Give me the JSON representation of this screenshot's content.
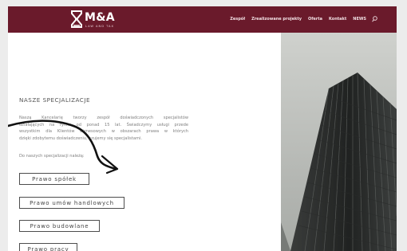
{
  "header": {
    "logo": {
      "name": "M&A",
      "subtitle": "LAW AND TAX",
      "mark_icon": "hourglass-logo"
    },
    "nav": [
      {
        "label": "Zespół"
      },
      {
        "label": "Zrealizowane projekty"
      },
      {
        "label": "Oferta"
      },
      {
        "label": "Kontakt"
      },
      {
        "label": "NEWS"
      }
    ],
    "search_icon": "search-icon"
  },
  "main": {
    "heading": "NASZE SPECJALIZACJE",
    "paragraph_lines": [
      "Naszą Kancelarię tworzy zespół doświadczonych specjalistów",
      "działających na rynku od ponad 15 lat. Świadczymy usługi przede",
      "wszystkim dla Klientów biznesowych w obszarach prawa w których",
      "dzięki zdobytemu doświadczeniu, czujemy się specjalistami."
    ],
    "intro": "Do naszych specjalizacji należą:",
    "buttons": [
      {
        "label": "Prawo spółek"
      },
      {
        "label": "Prawo umów handlowych"
      },
      {
        "label": "Prawo budowlane"
      },
      {
        "label": "Prawo pracy"
      }
    ]
  },
  "colors": {
    "header_bg": "#6a1a2b",
    "page_bg": "#ffffff",
    "outer_bg": "#ececec",
    "text_gray": "#808080",
    "button_border": "#4d4d4d",
    "arrow": "#111111"
  },
  "decorations": {
    "arrow": "hand-drawn-arrow",
    "photo": "skyscraper-photo"
  }
}
